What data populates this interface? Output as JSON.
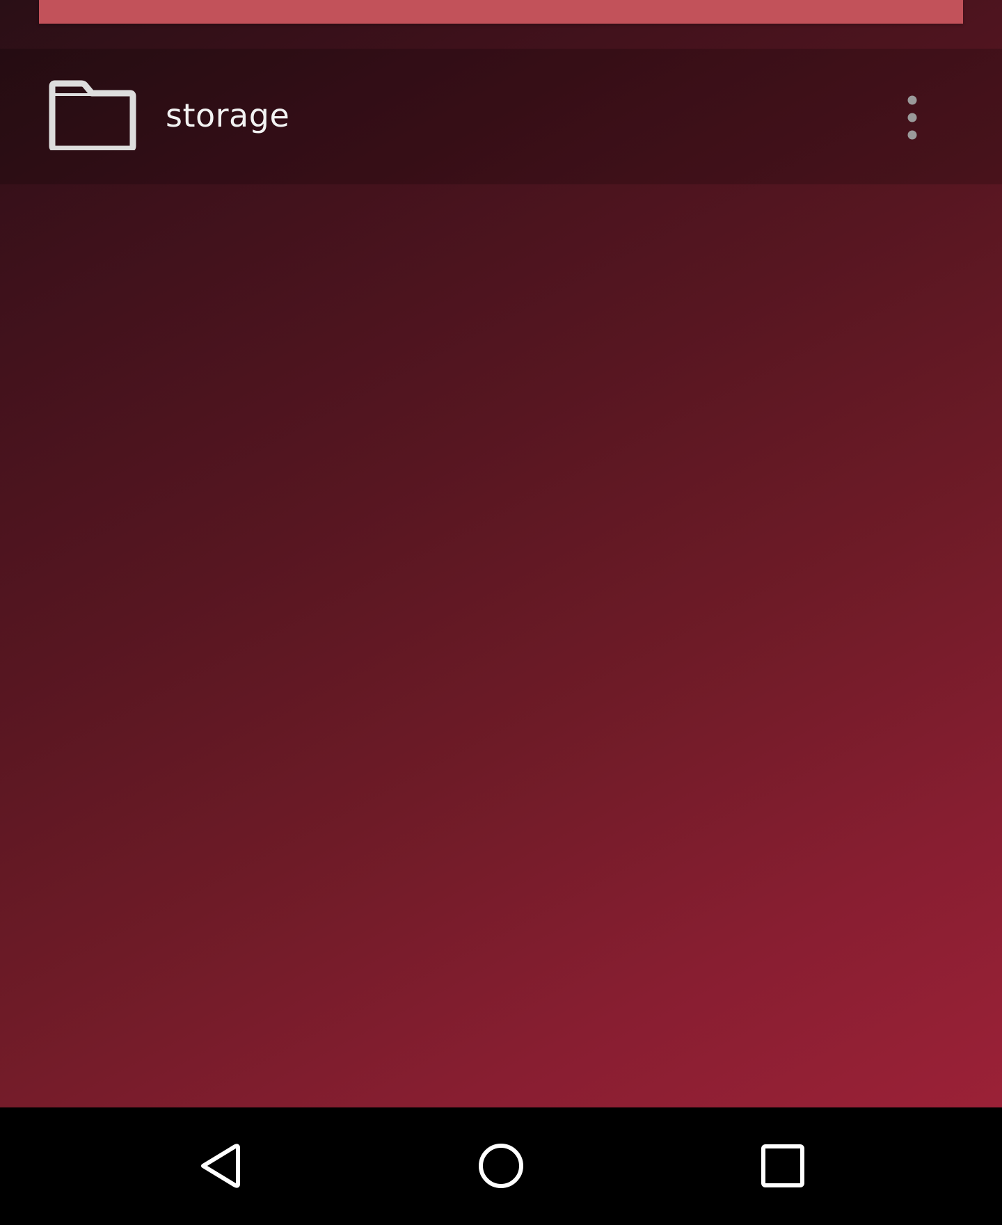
{
  "file_list": {
    "items": [
      {
        "label": "storage",
        "icon": "folder-icon"
      }
    ],
    "overflow_icon": "more-vert-icon"
  },
  "nav_bar": {
    "back_icon": "back-icon",
    "home_icon": "home-icon",
    "recents_icon": "recents-icon"
  },
  "colors": {
    "accent_bar": "#c2525a",
    "background_top": "#2a0f16",
    "background_bottom": "#9b2137",
    "text": "#f2f2f2",
    "nav_background": "#000000"
  }
}
